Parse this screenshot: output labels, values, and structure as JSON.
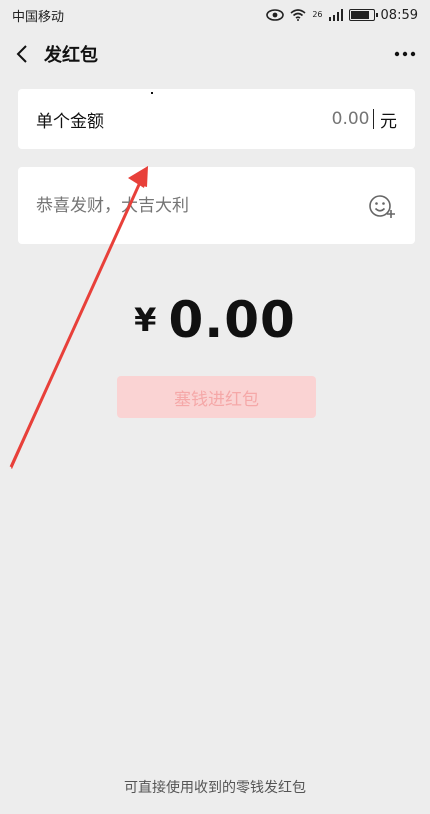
{
  "status_bar": {
    "carrier": "中国移动",
    "time": "08:59",
    "network": "26"
  },
  "nav": {
    "title": "发红包"
  },
  "amount_card": {
    "label": "单个金额",
    "value": "",
    "placeholder": "0.00",
    "unit": "元"
  },
  "greeting": {
    "placeholder": "恭喜发财，大吉大利"
  },
  "total": {
    "currency": "¥",
    "value": "0.00"
  },
  "submit": {
    "label": "塞钱进红包"
  },
  "footer": {
    "text": "可直接使用收到的零钱发红包"
  },
  "colors": {
    "background": "#EDEDED",
    "button_bg": "#FAD3D3",
    "button_text": "#F5A8A8",
    "annotation_arrow": "#E8403A"
  }
}
